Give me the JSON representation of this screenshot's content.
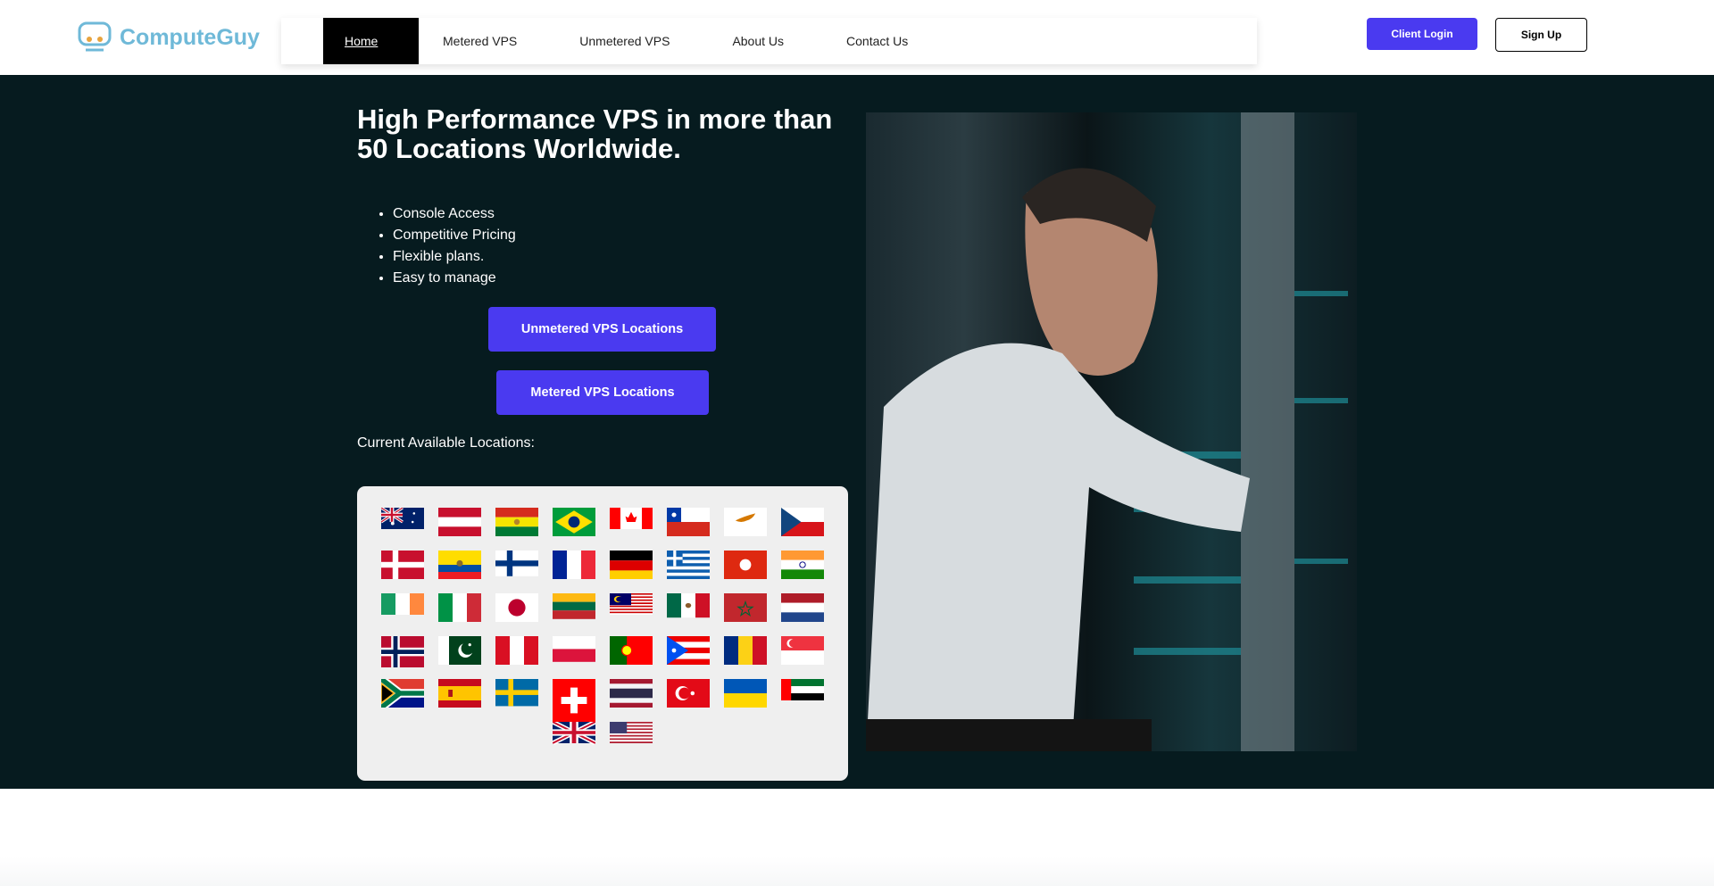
{
  "brand": {
    "name": "ComputeGuy",
    "logo_icon": "goggles-logo-icon"
  },
  "nav": {
    "items": [
      "Home",
      "Metered VPS",
      "Unmetered VPS",
      "About Us",
      "Contact Us"
    ],
    "active": "Home"
  },
  "header": {
    "login": "Client Login",
    "signup": "Sign Up"
  },
  "hero": {
    "title": "High Performance VPS in more than 50 Locations Worldwide.",
    "features": [
      "Console Access",
      "Competitive Pricing",
      "Flexible plans.",
      "Easy to manage"
    ],
    "buttons": [
      "Unmetered VPS Locations",
      "Metered VPS Locations"
    ],
    "locations_label": "Current Available Locations:",
    "image": "technician-in-server-room-photo"
  },
  "colors": {
    "accent": "#4a3af0",
    "hero_bg": "#061b1f",
    "logo": "#6fb9d8"
  },
  "flags": [
    "au",
    "at",
    "bo",
    "br",
    "ca",
    "cl",
    "cy",
    "cz",
    "dk",
    "ec",
    "fi",
    "fr",
    "de",
    "gr",
    "hk",
    "in",
    "ie",
    "it",
    "jp",
    "lt",
    "my",
    "mx",
    "ma",
    "nl",
    "no",
    "pk",
    "pe",
    "pl",
    "pt",
    "pr",
    "ro",
    "sg",
    "za",
    "es",
    "se",
    "ch",
    "th",
    "tr",
    "ua",
    "ae",
    "gb",
    "us"
  ]
}
